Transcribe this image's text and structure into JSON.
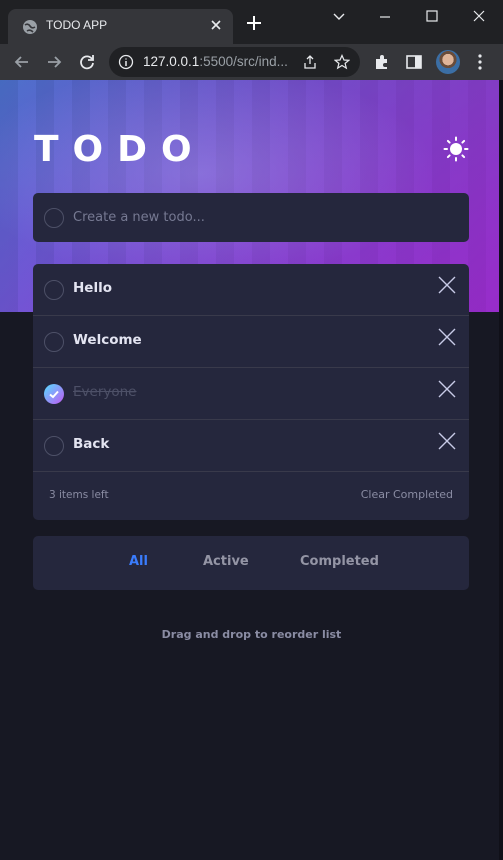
{
  "browser": {
    "tab_title": "TODO APP",
    "url_host": "127.0.0.1",
    "url_rest": ":5500/src/ind..."
  },
  "app": {
    "logo": "TODO",
    "new_todo_placeholder": "Create a new todo...",
    "todos": [
      {
        "text": "Hello",
        "completed": false
      },
      {
        "text": "Welcome",
        "completed": false
      },
      {
        "text": "Everyone",
        "completed": true
      },
      {
        "text": "Back",
        "completed": false
      }
    ],
    "items_left": "3 items left",
    "clear_label": "Clear Completed",
    "filters": [
      "All",
      "Active",
      "Completed"
    ],
    "active_filter": "All",
    "hint": "Drag and drop to reorder list"
  },
  "icons": {
    "tab": "globe-icon",
    "theme": "sun-icon",
    "delete": "close-icon",
    "check": "check-icon"
  },
  "colors": {
    "accent": "#3a7cfd",
    "card": "#25273d",
    "background": "#171823",
    "check_gradient_start": "#55ddff",
    "check_gradient_end": "#c058f3"
  }
}
